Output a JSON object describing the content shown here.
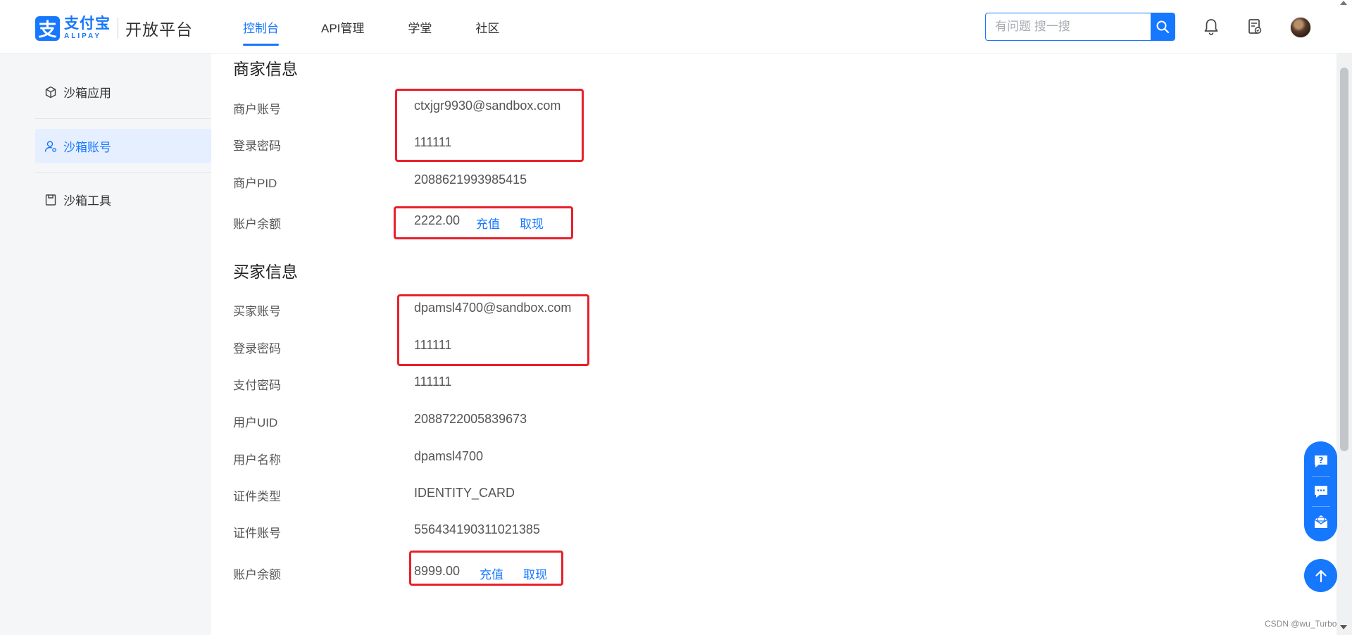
{
  "header": {
    "logo_cn": "支付宝",
    "logo_en": "ALIPAY",
    "platform": "开放平台",
    "nav": [
      {
        "label": "控制台",
        "active": true
      },
      {
        "label": "API管理",
        "active": false
      },
      {
        "label": "学堂",
        "active": false
      },
      {
        "label": "社区",
        "active": false
      }
    ],
    "search_placeholder": "有问题 搜一搜",
    "icons": [
      "search-icon",
      "bell-icon",
      "document-icon",
      "avatar"
    ]
  },
  "sidebar": {
    "items": [
      {
        "label": "沙箱应用",
        "icon": "cube-icon",
        "active": false
      },
      {
        "label": "沙箱账号",
        "icon": "user-icon",
        "active": true
      },
      {
        "label": "沙箱工具",
        "icon": "toolbox-icon",
        "active": false
      }
    ]
  },
  "merchant": {
    "title": "商家信息",
    "account_label": "商户账号",
    "account": "ctxjgr9930@sandbox.com",
    "login_pwd_label": "登录密码",
    "login_pwd": "111111",
    "pid_label": "商户PID",
    "pid": "2088621993985415",
    "balance_label": "账户余额",
    "balance": "2222.00",
    "recharge": "充值",
    "withdraw": "取现"
  },
  "buyer": {
    "title": "买家信息",
    "account_label": "买家账号",
    "account": "dpamsl4700@sandbox.com",
    "login_pwd_label": "登录密码",
    "login_pwd": "111111",
    "pay_pwd_label": "支付密码",
    "pay_pwd": "111111",
    "uid_label": "用户UID",
    "uid": "2088722005839673",
    "name_label": "用户名称",
    "name": "dpamsl4700",
    "id_type_label": "证件类型",
    "id_type": "IDENTITY_CARD",
    "id_no_label": "证件账号",
    "id_no": "556434190311021385",
    "balance_label": "账户余额",
    "balance": "8999.00",
    "recharge": "充值",
    "withdraw": "取现"
  },
  "float_toolbar": [
    "help-icon",
    "chat-icon",
    "mail-icon"
  ],
  "watermark": "CSDN @wu_Turbo",
  "colors": {
    "accent": "#1677ff",
    "highlight": "#e8202a",
    "sidebar_active_bg": "#e6efff"
  }
}
